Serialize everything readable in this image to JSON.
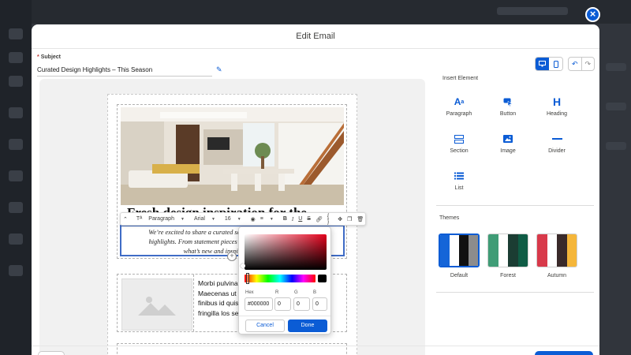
{
  "modal": {
    "title": "Edit Email",
    "subject_label": "Subject",
    "subject_value": "Curated Design Highlights – This Season"
  },
  "email": {
    "heading_peek": "Fresh design inspiration for the Season",
    "text_lines": [
      "We’re excited to share a curated selection of products that make",
      "highlights. From statement pieces to fresh finds, here’s a look at",
      "what’s new and inspiring this season."
    ],
    "row2_lines": [
      "Morbi pulvinar",
      "Maecenas ut l",
      "finibus id quis",
      "fringilla los sec"
    ]
  },
  "toolbar": {
    "format": "Paragraph",
    "font": "Arial",
    "size": "16"
  },
  "color_picker": {
    "hex_label": "Hex",
    "hex_value": "#000000",
    "r_label": "R",
    "r_value": "0",
    "g_label": "G",
    "g_value": "0",
    "b_label": "B",
    "b_value": "0",
    "cancel": "Cancel",
    "done": "Done"
  },
  "panel": {
    "insert_title": "Insert Element",
    "elements": [
      "Paragraph",
      "Button",
      "Heading",
      "Section",
      "Image",
      "Divider",
      "List"
    ],
    "themes_title": "Themes",
    "themes": [
      {
        "name": "Default",
        "colors": [
          "#1565d8",
          "#ffffff",
          "#111111",
          "#8c8c8c"
        ]
      },
      {
        "name": "Forest",
        "colors": [
          "#3f9c76",
          "#ffffff",
          "#1b3d33",
          "#0f5c45"
        ]
      },
      {
        "name": "Autumn",
        "colors": [
          "#d8394a",
          "#ffffff",
          "#3a2a2a",
          "#f5b63a"
        ]
      }
    ]
  }
}
